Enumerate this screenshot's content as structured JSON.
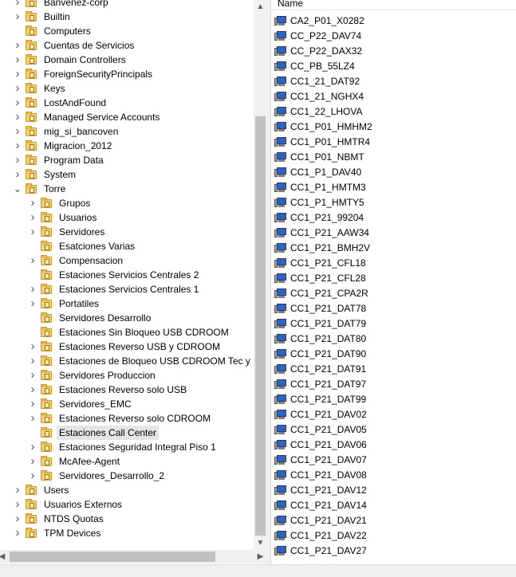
{
  "tree": {
    "items": [
      {
        "label": "Banvenez-corp",
        "level": 0,
        "expander": "collapsed"
      },
      {
        "label": "Builtin",
        "level": 0,
        "expander": "collapsed"
      },
      {
        "label": "Computers",
        "level": 0,
        "expander": "none"
      },
      {
        "label": "Cuentas de Servicios",
        "level": 0,
        "expander": "collapsed"
      },
      {
        "label": "Domain Controllers",
        "level": 0,
        "expander": "collapsed"
      },
      {
        "label": "ForeignSecurityPrincipals",
        "level": 0,
        "expander": "collapsed"
      },
      {
        "label": "Keys",
        "level": 0,
        "expander": "collapsed"
      },
      {
        "label": "LostAndFound",
        "level": 0,
        "expander": "collapsed"
      },
      {
        "label": "Managed Service Accounts",
        "level": 0,
        "expander": "collapsed"
      },
      {
        "label": "mig_si_bancoven",
        "level": 0,
        "expander": "collapsed"
      },
      {
        "label": "Migracion_2012",
        "level": 0,
        "expander": "collapsed"
      },
      {
        "label": "Program Data",
        "level": 0,
        "expander": "collapsed"
      },
      {
        "label": "System",
        "level": 0,
        "expander": "collapsed"
      },
      {
        "label": "Torre",
        "level": 0,
        "expander": "expanded"
      },
      {
        "label": "Grupos",
        "level": 1,
        "expander": "collapsed"
      },
      {
        "label": "Usuarios",
        "level": 1,
        "expander": "collapsed"
      },
      {
        "label": "Servidores",
        "level": 1,
        "expander": "collapsed"
      },
      {
        "label": "Esatciones Varias",
        "level": 1,
        "expander": "none"
      },
      {
        "label": "Compensacion",
        "level": 1,
        "expander": "collapsed"
      },
      {
        "label": "Estaciones Servicios Centrales 2",
        "level": 1,
        "expander": "none"
      },
      {
        "label": "Estaciones Servicios Centrales 1",
        "level": 1,
        "expander": "collapsed"
      },
      {
        "label": "Portatiles",
        "level": 1,
        "expander": "collapsed"
      },
      {
        "label": "Servidores Desarrollo",
        "level": 1,
        "expander": "none"
      },
      {
        "label": "Estaciones Sin Bloqueo USB CDROOM",
        "level": 1,
        "expander": "none"
      },
      {
        "label": "Estaciones Reverso USB y CDROOM",
        "level": 1,
        "expander": "collapsed"
      },
      {
        "label": "Estaciones de Bloqueo USB CDROOM Tec y Sis",
        "level": 1,
        "expander": "collapsed"
      },
      {
        "label": "Servidores Produccion",
        "level": 1,
        "expander": "collapsed"
      },
      {
        "label": "Estaciones Reverso solo USB",
        "level": 1,
        "expander": "collapsed"
      },
      {
        "label": "Servidores_EMC",
        "level": 1,
        "expander": "collapsed"
      },
      {
        "label": "Estaciones Reverso solo CDROOM",
        "level": 1,
        "expander": "collapsed"
      },
      {
        "label": "Estaciones Call Center",
        "level": 1,
        "expander": "none",
        "selected": true
      },
      {
        "label": "Estaciones Seguridad Integral Piso 1",
        "level": 1,
        "expander": "collapsed"
      },
      {
        "label": "McAfee-Agent",
        "level": 1,
        "expander": "collapsed"
      },
      {
        "label": "Servidores_Desarrollo_2",
        "level": 1,
        "expander": "collapsed"
      },
      {
        "label": "Users",
        "level": 0,
        "expander": "collapsed"
      },
      {
        "label": "Usuarios Externos",
        "level": 0,
        "expander": "collapsed"
      },
      {
        "label": "NTDS Quotas",
        "level": 0,
        "expander": "collapsed"
      },
      {
        "label": "TPM Devices",
        "level": 0,
        "expander": "collapsed"
      }
    ]
  },
  "list": {
    "column_header": "Name",
    "items": [
      "CA2_P01_X0282",
      "CC_P22_DAV74",
      "CC_P22_DAX32",
      "CC_PB_55LZ4",
      "CC1_21_DAT92",
      "CC1_21_NGHX4",
      "CC1_22_LHOVA",
      "CC1_P01_HMHM2",
      "CC1_P01_HMTR4",
      "CC1_P01_NBMT",
      "CC1_P1_DAV40",
      "CC1_P1_HMTM3",
      "CC1_P1_HMTY5",
      "CC1_P21_99204",
      "CC1_P21_AAW34",
      "CC1_P21_BMH2V",
      "CC1_P21_CFL18",
      "CC1_P21_CFL28",
      "CC1_P21_CPA2R",
      "CC1_P21_DAT78",
      "CC1_P21_DAT79",
      "CC1_P21_DAT80",
      "CC1_P21_DAT90",
      "CC1_P21_DAT91",
      "CC1_P21_DAT97",
      "CC1_P21_DAT99",
      "CC1_P21_DAV02",
      "CC1_P21_DAV05",
      "CC1_P21_DAV06",
      "CC1_P21_DAV07",
      "CC1_P21_DAV08",
      "CC1_P21_DAV12",
      "CC1_P21_DAV14",
      "CC1_P21_DAV21",
      "CC1_P21_DAV22",
      "CC1_P21_DAV27"
    ]
  },
  "icons": {
    "folder": "ou-folder-icon",
    "computer": "computer-icon",
    "expand_collapsed": "chevron-right-icon",
    "expand_expanded": "chevron-down-icon"
  },
  "colors": {
    "selection": "#e5e5e5",
    "scrollbar_track": "#f0f0f0",
    "scrollbar_thumb": "#c1c1c1",
    "folder_fill": "#f6d06e"
  }
}
